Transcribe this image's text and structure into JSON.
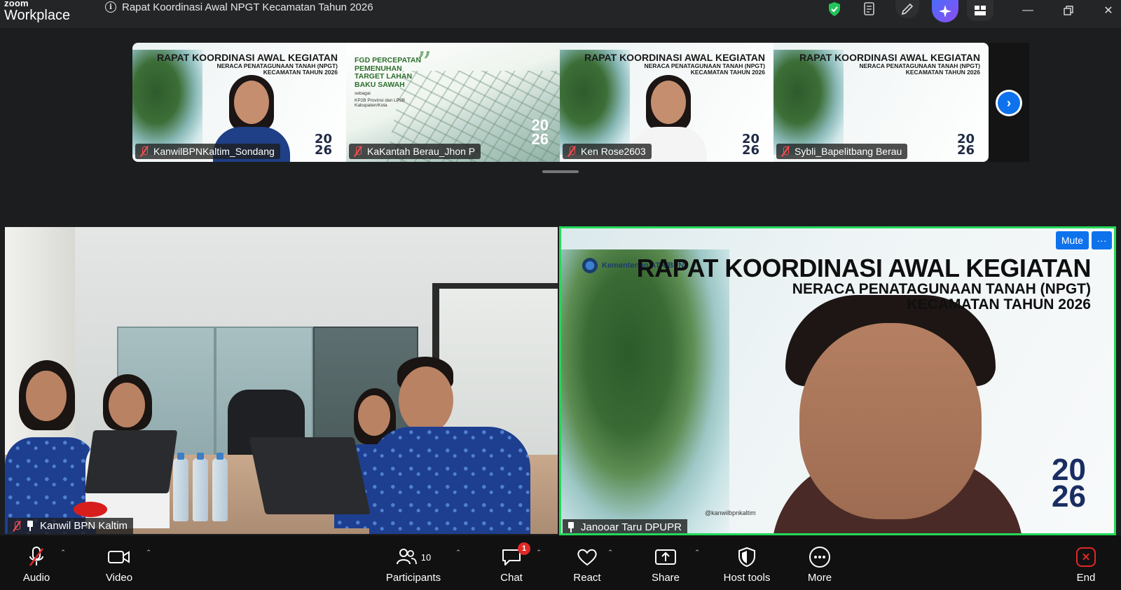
{
  "app": {
    "brand_top": "zoom",
    "brand_bottom": "Workplace",
    "meeting_title": "Rapat Koordinasi Awal NPGT Kecamatan Tahun 2026"
  },
  "thumbnails": [
    {
      "name": "KanwilBPNKaltim_Sondang",
      "slide_title": "RAPAT KOORDINASI AWAL KEGIATAN",
      "slide_sub1": "NERACA PENATAGUNAAN TANAH (NPGT)",
      "slide_sub2": "KECAMATAN TAHUN 2026",
      "year_top": "20",
      "year_bottom": "26"
    },
    {
      "name": "KaKantah Berau_Jhon P",
      "slide_title": "FGD PERCEPATAN PEMENUHAN TARGET LAHAN BAKU SAWAH",
      "slide_sub1": "sebagai",
      "slide_sub2": "KP2B Provinsi dan LP2B Kabupaten/Kota",
      "year_top": "20",
      "year_bottom": "26"
    },
    {
      "name": "Ken Rose2603",
      "slide_title": "RAPAT KOORDINASI AWAL KEGIATAN",
      "slide_sub1": "NERACA PENATAGUNAAN TANAH (NPGT)",
      "slide_sub2": "KECAMATAN TAHUN 2026",
      "year_top": "20",
      "year_bottom": "26"
    },
    {
      "name": "Sybli_Bapelitbang Berau",
      "slide_title": "RAPAT KOORDINASI AWAL KEGIATAN",
      "slide_sub1": "NERACA PENATAGUNAAN TANAH (NPGT)",
      "slide_sub2": "KECAMATAN TAHUN 2026",
      "year_top": "20",
      "year_bottom": "26"
    }
  ],
  "main_videos": {
    "left_name": "Kanwil BPN Kaltim",
    "right_name": "Janooar Taru DPUPR",
    "right_slide": {
      "logo_text": "Kementerian ATR/BPN",
      "title": "RAPAT KOORDINASI AWAL KEGIATAN",
      "sub1": "NERACA PENATAGUNAAN TANAH (NPGT)",
      "sub2": "KECAMATAN TAHUN 2026",
      "year_top": "20",
      "year_bottom": "26",
      "handle": "@kanwilbpnkaltim"
    },
    "mute_label": "Mute",
    "more_label": "···"
  },
  "toolbar": {
    "audio": "Audio",
    "video": "Video",
    "participants": "Participants",
    "participants_count": "10",
    "chat": "Chat",
    "chat_badge": "1",
    "react": "React",
    "share": "Share",
    "host_tools": "Host tools",
    "more": "More",
    "end": "End"
  },
  "colors": {
    "accent_blue": "#0e72ed",
    "active_speaker": "#23d959",
    "end_red": "#e02828",
    "muted_red": "#ff4d4f"
  }
}
